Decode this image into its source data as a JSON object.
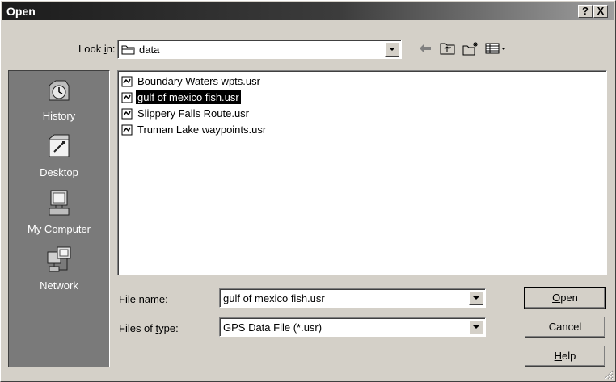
{
  "window": {
    "title": "Open",
    "help_btn": "?",
    "close_btn": "X"
  },
  "look_in": {
    "label": "Look in:",
    "value": "data"
  },
  "toolbar": {
    "icons": [
      "back-arrow-icon",
      "up-folder-icon",
      "new-folder-icon",
      "view-menu-icon"
    ]
  },
  "places": [
    {
      "label": "History",
      "icon": "history-icon"
    },
    {
      "label": "Desktop",
      "icon": "desktop-icon"
    },
    {
      "label": "My Computer",
      "icon": "my-computer-icon"
    },
    {
      "label": "Network",
      "icon": "network-icon"
    }
  ],
  "files": [
    {
      "name": "Boundary Waters wpts.usr",
      "selected": false
    },
    {
      "name": "gulf of mexico fish.usr",
      "selected": true
    },
    {
      "name": "Slippery Falls Route.usr",
      "selected": false
    },
    {
      "name": "Truman Lake waypoints.usr",
      "selected": false
    }
  ],
  "file_name": {
    "label": "File name:",
    "value": "gulf of mexico fish.usr"
  },
  "file_type": {
    "label": "Files of type:",
    "value": "GPS Data File (*.usr)"
  },
  "buttons": {
    "open": "Open",
    "cancel": "Cancel",
    "help": "Help"
  },
  "colors": {
    "selection": "#000000",
    "places_bar": "#7a7a7a",
    "face": "#d4d0c8"
  }
}
